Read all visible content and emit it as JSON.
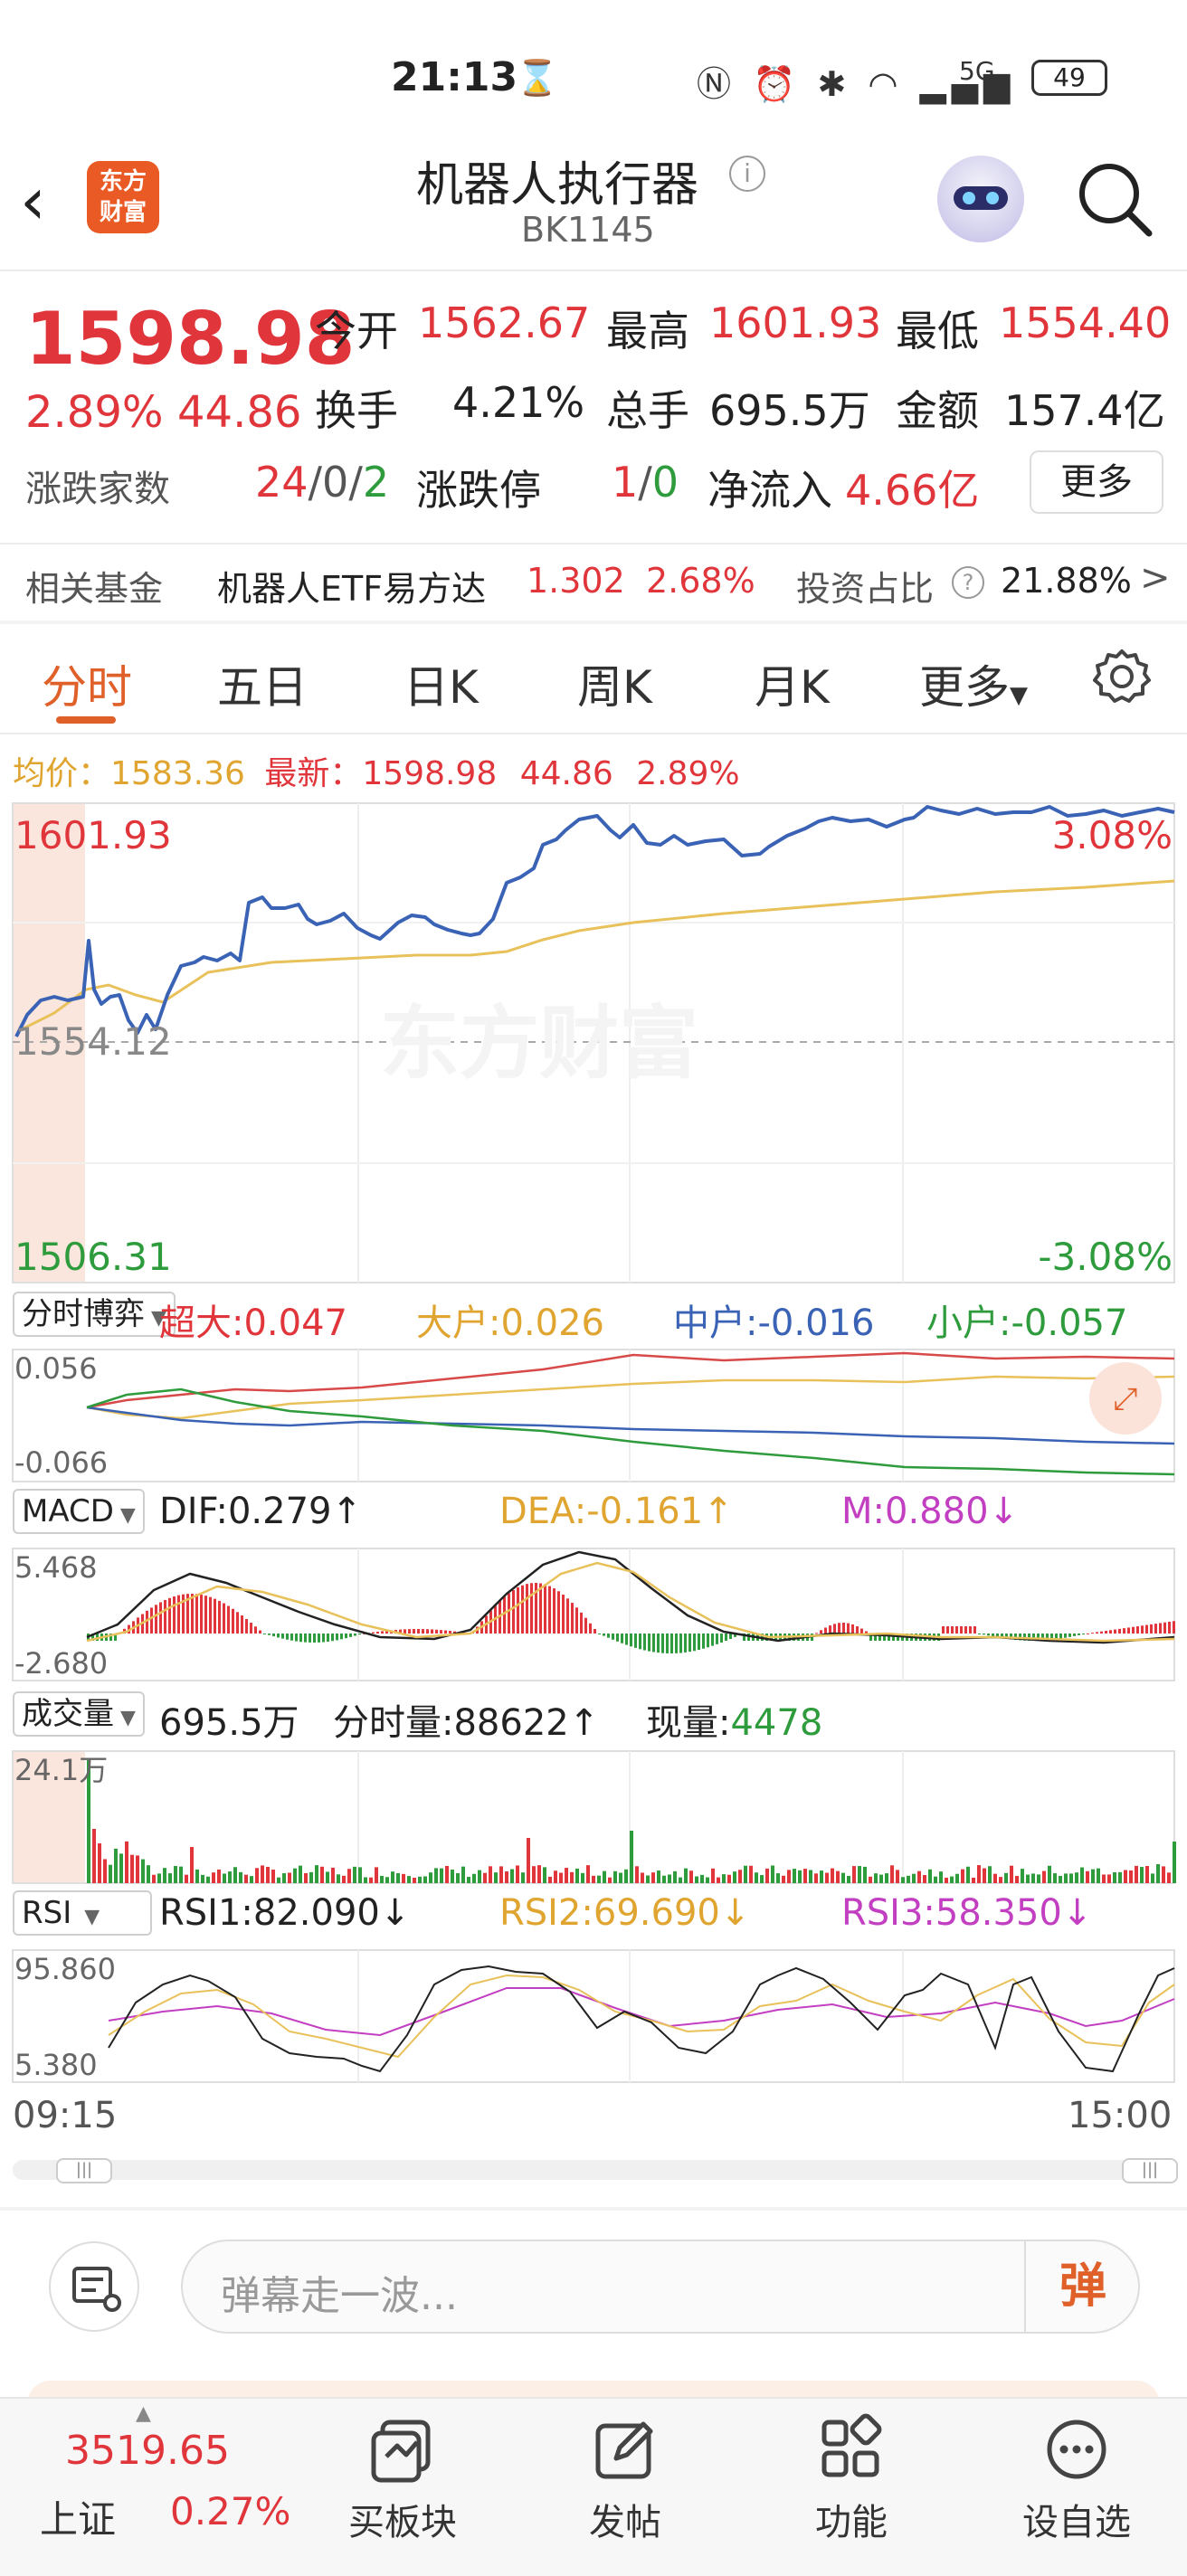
{
  "status_bar": {
    "time": "21:13",
    "battery": "49",
    "network": "5G"
  },
  "header": {
    "title": "机器人执行器",
    "code": "BK1145",
    "logo_text": "东方\n财富"
  },
  "quote": {
    "price": "1598.98",
    "change_pct": "2.89%",
    "change": "44.86",
    "open_label": "今开",
    "open": "1562.67",
    "high_label": "最高",
    "high": "1601.93",
    "low_label": "最低",
    "low": "1554.40",
    "turnover_label": "换手",
    "turnover": "4.21%",
    "volume_label": "总手",
    "volume": "695.5万",
    "amount_label": "金额",
    "amount": "157.4亿",
    "updown_label": "涨跌家数",
    "up": "24",
    "flat": "0",
    "down": "2",
    "limit_label": "涨跌停",
    "limit_up": "1",
    "limit_down": "0",
    "inflow_label": "净流入",
    "inflow": "4.66亿",
    "more": "更多"
  },
  "fund": {
    "label": "相关基金",
    "name": "机器人ETF易方达",
    "price": "1.302",
    "pct": "2.68%",
    "ratio_label": "投资占比",
    "ratio": "21.88%"
  },
  "tabs": [
    "分时",
    "五日",
    "日K",
    "周K",
    "月K",
    "更多"
  ],
  "info_line": {
    "avg_label": "均价：",
    "avg": "1583.36",
    "latest_label": "最新：",
    "latest": "1598.98",
    "change": "44.86",
    "pct": "2.89%"
  },
  "main_chart": {
    "top": "1601.93",
    "mid": "1554.12",
    "bottom": "1506.31",
    "top_pct": "3.08%",
    "bottom_pct": "-3.08%",
    "watermark": "东方财富"
  },
  "fund_flow": {
    "selector": "分时博弈",
    "super_label": "超大:",
    "super": "0.047",
    "large_label": "大户:",
    "large": "0.026",
    "medium_label": "中户:",
    "medium": "-0.016",
    "small_label": "小户:",
    "small": "-0.057",
    "max": "0.056",
    "min": "-0.066"
  },
  "macd": {
    "selector": "MACD",
    "dif_label": "DIF:",
    "dif": "0.279↑",
    "dea_label": "DEA:",
    "dea": "-0.161↑",
    "m_label": "M:",
    "m": "0.880↓",
    "max": "5.468",
    "min": "-2.680"
  },
  "volume": {
    "selector": "成交量",
    "total": "695.5万",
    "tick_label": "分时量:",
    "tick": "88622↑",
    "now_label": "现量:",
    "now": "4478",
    "max": "24.1万"
  },
  "rsi": {
    "selector": "RSI",
    "rsi1_label": "RSI1:",
    "rsi1": "82.090↓",
    "rsi2_label": "RSI2:",
    "rsi2": "69.690↓",
    "rsi3_label": "RSI3:",
    "rsi3": "58.350↓",
    "max": "95.860",
    "min": "5.380"
  },
  "time_axis": {
    "start": "09:15",
    "end": "15:00"
  },
  "danmu": {
    "placeholder": "弹幕走一波...",
    "button": "弹"
  },
  "bottom_bar": {
    "index_value": "3519.65",
    "index_name": "上证",
    "index_pct": "0.27%",
    "items": [
      "买板块",
      "发帖",
      "功能",
      "设自选"
    ]
  },
  "colors": {
    "up": "#e0353b",
    "down": "#2e9b3c",
    "accent": "#e0602a",
    "price_line": "#3a62b5",
    "avg_line": "#e8c15a"
  }
}
